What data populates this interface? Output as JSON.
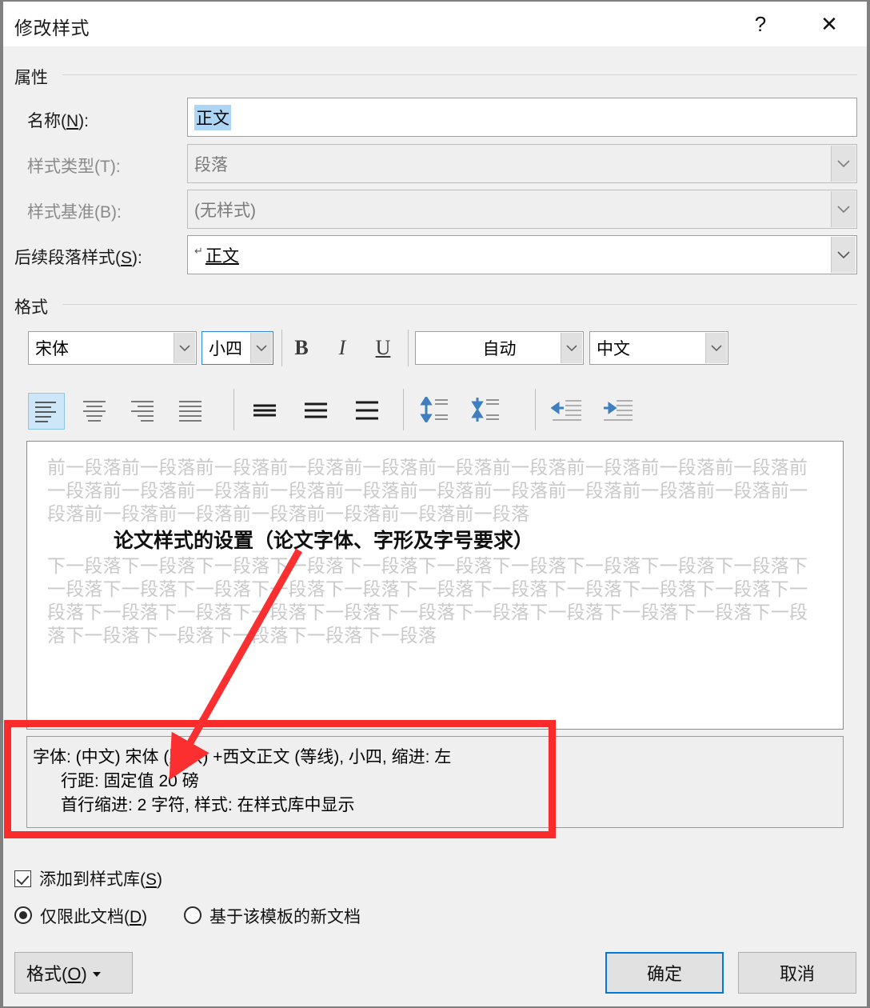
{
  "dialog": {
    "title": "修改样式",
    "help_icon": "?",
    "close_icon": "✕"
  },
  "properties": {
    "group_label": "属性",
    "fields": [
      {
        "label": "名称(N):",
        "value": "正文",
        "type": "textbox",
        "selected": true
      },
      {
        "label": "样式类型(T):",
        "value": "段落",
        "type": "combo",
        "disabled": true
      },
      {
        "label": "样式基准(B):",
        "value": "(无样式)",
        "type": "combo",
        "disabled": true
      },
      {
        "label": "后续段落样式(S):",
        "value": "正文",
        "type": "combo",
        "disabled": false
      }
    ]
  },
  "format": {
    "group_label": "格式",
    "font_family": "宋体",
    "font_size": "小四",
    "bold_label": "B",
    "italic_label": "I",
    "underline_label": "U",
    "font_color": "自动",
    "language": "中文",
    "alignment_icons": [
      "align-left-icon",
      "align-center-icon",
      "align-right-icon",
      "align-justify-icon"
    ],
    "alignment_active_index": 0,
    "linespacing_icons": [
      "line-spacing-single-icon",
      "line-spacing-1-5-icon",
      "line-spacing-double-icon"
    ],
    "paragraph_space_icons": [
      "increase-paragraph-spacing-icon",
      "decrease-paragraph-spacing-icon"
    ],
    "indent_icons": [
      "decrease-indent-icon",
      "increase-indent-icon"
    ]
  },
  "preview": {
    "before_text": "前一段落前一段落前一段落前一段落前一段落前一段落前一段落前一段落前一段落前一段落前一段落前一段落前一段落前一段落前一段落前一段落前一段落前一段落前一段落前一段落前一段落前一段落前一段落前一段落前一段落前一段落前一段落",
    "sample_text": "论文样式的设置（论文字体、字形及字号要求）",
    "after_text": "下一段落下一段落下一段落下一段落下一段落下一段落下一段落下一段落下一段落下一段落下一段落下一段落下一段落下一段落下一段落下一段落下一段落下一段落下一段落下一段落下一段落下一段落下一段落下一段落下一段落下一段落下一段落下一段落下一段落下一段落下一段落下一段落下一段落下一段落下一段落下一段落"
  },
  "description": {
    "line1": "字体: (中文) 宋体 (默认) +西文正文 (等线), 小四, 缩进: 左",
    "line2": "行距: 固定值 20 磅",
    "line3": "首行缩进:  2 字符, 样式: 在样式库中显示",
    "highlight_color": "#fa2b2b"
  },
  "options": {
    "add_to_gallery_label": "添加到样式库(S)",
    "add_to_gallery_checked": true,
    "scope_selected_index": 0,
    "scope_options": [
      "仅限此文档(D)",
      "基于该模板的新文档"
    ]
  },
  "footer": {
    "format_button": "格式(O)",
    "ok_button": "确定",
    "cancel_button": "取消"
  }
}
